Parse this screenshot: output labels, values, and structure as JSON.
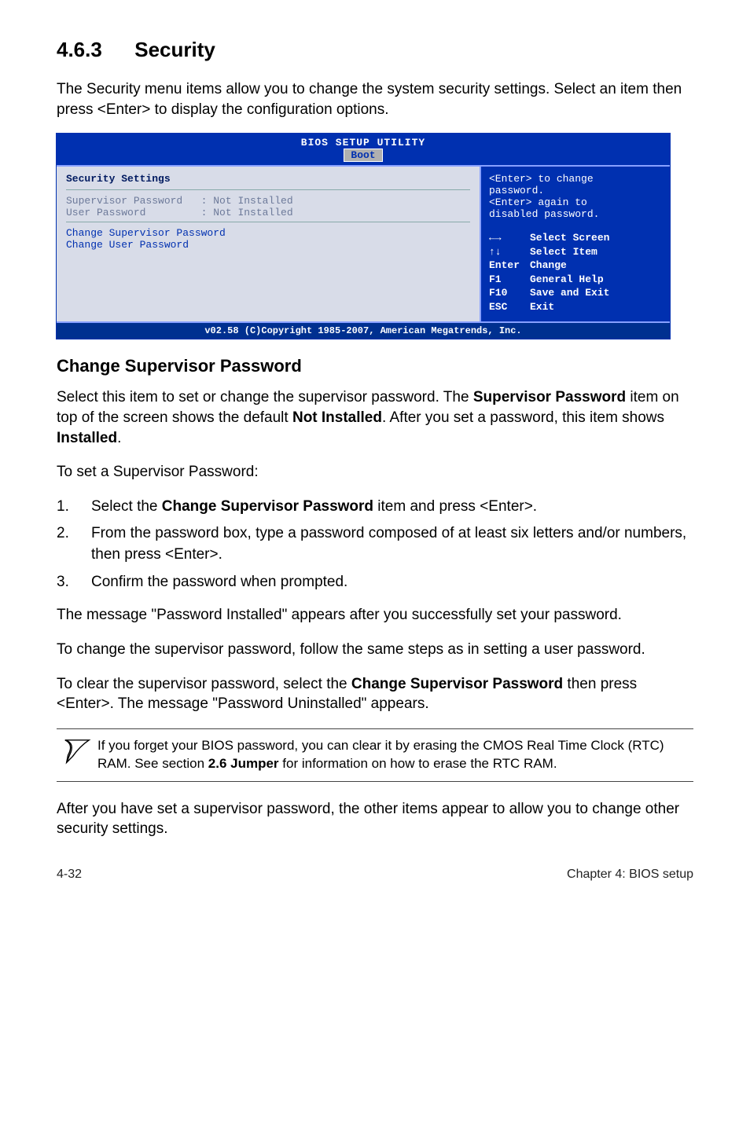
{
  "section": {
    "number": "4.6.3",
    "title": "Security"
  },
  "intro": "The Security menu items allow you to change the system security settings. Select an item then press <Enter> to display the configuration options.",
  "bios": {
    "title": "BIOS SETUP UTILITY",
    "tab": "Boot",
    "left": {
      "heading": "Security Settings",
      "rows": [
        {
          "label": "Supervisor Password",
          "value": ": Not Installed"
        },
        {
          "label": "User Password",
          "value": ": Not Installed"
        }
      ],
      "items": [
        "Change Supervisor Password",
        "Change User Password"
      ]
    },
    "right": {
      "hint1": "<Enter> to change",
      "hint2": "password.",
      "hint3": "<Enter> again to",
      "hint4": "disabled password.",
      "nav": [
        {
          "k": "←→",
          "v": "Select Screen"
        },
        {
          "k": "↑↓",
          "v": "Select Item"
        },
        {
          "k": "Enter",
          "v": "Change"
        },
        {
          "k": "F1",
          "v": "General Help"
        },
        {
          "k": "F10",
          "v": "Save and Exit"
        },
        {
          "k": "ESC",
          "v": "Exit"
        }
      ]
    },
    "footer": "v02.58 (C)Copyright 1985-2007, American Megatrends, Inc."
  },
  "sub1": {
    "title": "Change Supervisor Password",
    "p1a": "Select this item to set or change the supervisor password. The ",
    "p1b": "Supervisor Password",
    "p1c": " item on top of the screen shows the default ",
    "p1d": "Not Installed",
    "p1e": ". After you set a password, this item shows ",
    "p1f": "Installed",
    "p1g": ".",
    "p2": "To set a Supervisor Password:",
    "steps": [
      {
        "n": "1.",
        "pre": "Select the ",
        "b": "Change Supervisor Password",
        "post": " item and press <Enter>."
      },
      {
        "n": "2.",
        "pre": "From the password box, type a password composed of at least six letters and/or numbers, then press <Enter>.",
        "b": "",
        "post": ""
      },
      {
        "n": "3.",
        "pre": "Confirm the password when prompted.",
        "b": "",
        "post": ""
      }
    ],
    "p3": "The message \"Password Installed\" appears after you successfully set your password.",
    "p4": "To change the supervisor password, follow the same steps as in setting a user password.",
    "p5a": "To clear the supervisor password, select the ",
    "p5b": "Change Supervisor Password",
    "p5c": " then press <Enter>. The message \"Password Uninstalled\" appears."
  },
  "note": {
    "a": "If you forget your BIOS password, you can clear it by erasing the CMOS Real Time Clock (RTC) RAM. See section ",
    "b": "2.6 Jumper",
    "c": " for information on how to erase the RTC RAM."
  },
  "after_note": "After you have set a supervisor password, the other items appear to allow you to change other security settings.",
  "footer": {
    "left": "4-32",
    "right": "Chapter 4: BIOS setup"
  }
}
